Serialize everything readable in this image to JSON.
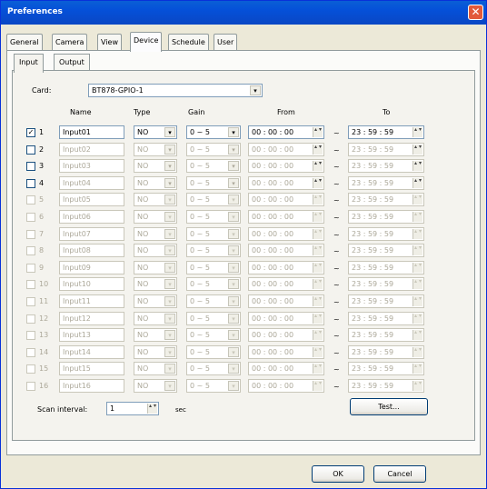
{
  "window": {
    "title": "Preferences",
    "close_glyph": "✕"
  },
  "main_tabs": [
    "General",
    "Camera",
    "View",
    "Device",
    "Schedule",
    "User"
  ],
  "sub_tabs": [
    "Input",
    "Output"
  ],
  "card": {
    "label": "Card:",
    "value": "BT878-GPIO-1"
  },
  "headers": {
    "name": "Name",
    "type": "Type",
    "gain": "Gain",
    "from": "From",
    "to": "To"
  },
  "rows": [
    {
      "num": "1",
      "checked": true,
      "name": "Input01",
      "type": "NO",
      "gain": "0 ~ 5",
      "from": "00 : 00 : 00",
      "to": "23 : 59 : 59"
    },
    {
      "num": "2",
      "checked": false,
      "name": "Input02",
      "type": "NO",
      "gain": "0 ~ 5",
      "from": "00 : 00 : 00",
      "to": "23 : 59 : 59"
    },
    {
      "num": "3",
      "checked": false,
      "name": "Input03",
      "type": "NO",
      "gain": "0 ~ 5",
      "from": "00 : 00 : 00",
      "to": "23 : 59 : 59"
    },
    {
      "num": "4",
      "checked": false,
      "name": "Input04",
      "type": "NO",
      "gain": "0 ~ 5",
      "from": "00 : 00 : 00",
      "to": "23 : 59 : 59"
    },
    {
      "num": "5",
      "checked": false,
      "name": "Input05",
      "type": "NO",
      "gain": "0 ~ 5",
      "from": "00 : 00 : 00",
      "to": "23 : 59 : 59"
    },
    {
      "num": "6",
      "checked": false,
      "name": "Input06",
      "type": "NO",
      "gain": "0 ~ 5",
      "from": "00 : 00 : 00",
      "to": "23 : 59 : 59"
    },
    {
      "num": "7",
      "checked": false,
      "name": "Input07",
      "type": "NO",
      "gain": "0 ~ 5",
      "from": "00 : 00 : 00",
      "to": "23 : 59 : 59"
    },
    {
      "num": "8",
      "checked": false,
      "name": "Input08",
      "type": "NO",
      "gain": "0 ~ 5",
      "from": "00 : 00 : 00",
      "to": "23 : 59 : 59"
    },
    {
      "num": "9",
      "checked": false,
      "name": "Input09",
      "type": "NO",
      "gain": "0 ~ 5",
      "from": "00 : 00 : 00",
      "to": "23 : 59 : 59"
    },
    {
      "num": "10",
      "checked": false,
      "name": "Input10",
      "type": "NO",
      "gain": "0 ~ 5",
      "from": "00 : 00 : 00",
      "to": "23 : 59 : 59"
    },
    {
      "num": "11",
      "checked": false,
      "name": "Input11",
      "type": "NO",
      "gain": "0 ~ 5",
      "from": "00 : 00 : 00",
      "to": "23 : 59 : 59"
    },
    {
      "num": "12",
      "checked": false,
      "name": "Input12",
      "type": "NO",
      "gain": "0 ~ 5",
      "from": "00 : 00 : 00",
      "to": "23 : 59 : 59"
    },
    {
      "num": "13",
      "checked": false,
      "name": "Input13",
      "type": "NO",
      "gain": "0 ~ 5",
      "from": "00 : 00 : 00",
      "to": "23 : 59 : 59"
    },
    {
      "num": "14",
      "checked": false,
      "name": "Input14",
      "type": "NO",
      "gain": "0 ~ 5",
      "from": "00 : 00 : 00",
      "to": "23 : 59 : 59"
    },
    {
      "num": "15",
      "checked": false,
      "name": "Input15",
      "type": "NO",
      "gain": "0 ~ 5",
      "from": "00 : 00 : 00",
      "to": "23 : 59 : 59"
    },
    {
      "num": "16",
      "checked": false,
      "name": "Input16",
      "type": "NO",
      "gain": "0 ~ 5",
      "from": "00 : 00 : 00",
      "to": "23 : 59 : 59"
    }
  ],
  "range_sep": "~",
  "scan": {
    "label": "Scan interval:",
    "value": "1",
    "unit": "sec"
  },
  "buttons": {
    "test": "Test...",
    "ok": "OK",
    "cancel": "Cancel"
  },
  "glyphs": {
    "checkmark": "✓",
    "dropdown": "▾",
    "spin": "▴\n▾"
  }
}
